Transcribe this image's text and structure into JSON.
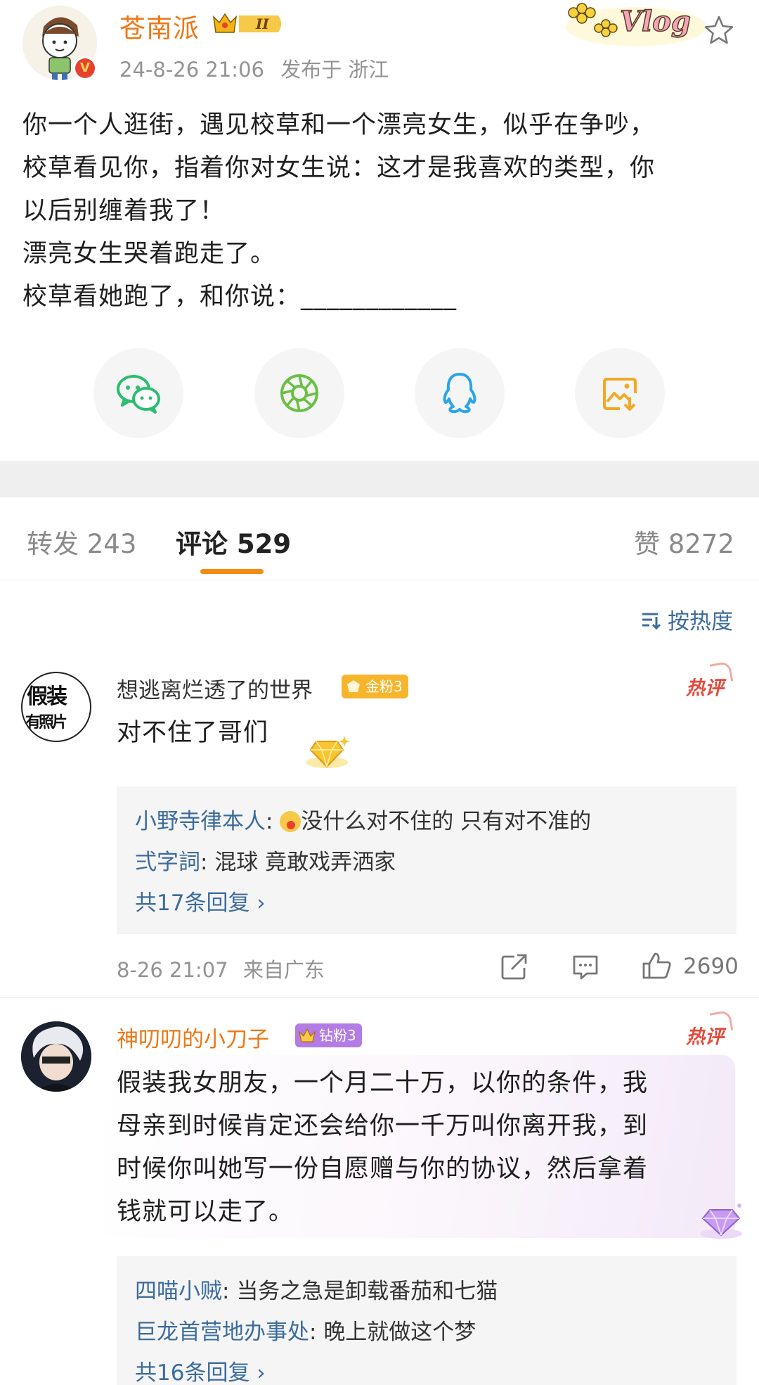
{
  "post": {
    "author": "苍南派",
    "time": "24-8-26 21:06",
    "location": "发布于 浙江",
    "vlog_sticker": "Vlog",
    "vip_level": "II",
    "lines": [
      "你一个人逛街，遇见校草和一个漂亮女生，似乎在争吵，",
      "校草看见你，指着你对女生说：这才是我喜欢的类型，你",
      "以后别缠着我了！",
      "漂亮女生哭着跑走了。",
      "校草看她跑了，和你说：____________"
    ]
  },
  "share": [
    {
      "icon": "wechat-icon"
    },
    {
      "icon": "moments-icon"
    },
    {
      "icon": "qq-icon"
    },
    {
      "icon": "save-image-icon"
    }
  ],
  "tabs": {
    "reposts": "转发 243",
    "comments": "评论 529",
    "likes": "赞 8272"
  },
  "sort_label": "按热度",
  "comments": [
    {
      "user": "想逃离烂透了的世界",
      "fan_badge": "金粉3",
      "hot": "热评",
      "avatar_text": [
        "假装",
        "有照片"
      ],
      "text": [
        "对不住了哥们"
      ],
      "replies": [
        {
          "user": "小野寺律本人",
          "text": "没什么对不住的 只有对不准的"
        },
        {
          "user": "弍字詞",
          "text": "混球 竟敢戏弄洒家"
        }
      ],
      "more": "共17条回复 ›",
      "time": "8-26 21:07",
      "location": "来自广东",
      "likes": "2690"
    },
    {
      "user": "神叨叨的小刀子",
      "fan_badge": "钻粉3",
      "hot": "热评",
      "text": [
        "假装我女朋友，一个月二十万，以你的条件，我",
        "母亲到时候肯定还会给你一千万叫你离开我，到",
        "时候你叫她写一份自愿赠与你的协议，然后拿着",
        "钱就可以走了。"
      ],
      "replies": [
        {
          "user": "四喵小贼",
          "text": "当务之急是卸载番茄和七猫"
        },
        {
          "user": "巨龙首营地办事处",
          "text": "晚上就做这个梦"
        }
      ],
      "more": "共16条回复 ›"
    }
  ],
  "colors": {
    "accent": "#f48b12",
    "author": "#ee7716",
    "link": "#3c6c9c",
    "hot": "#e34b3c"
  }
}
